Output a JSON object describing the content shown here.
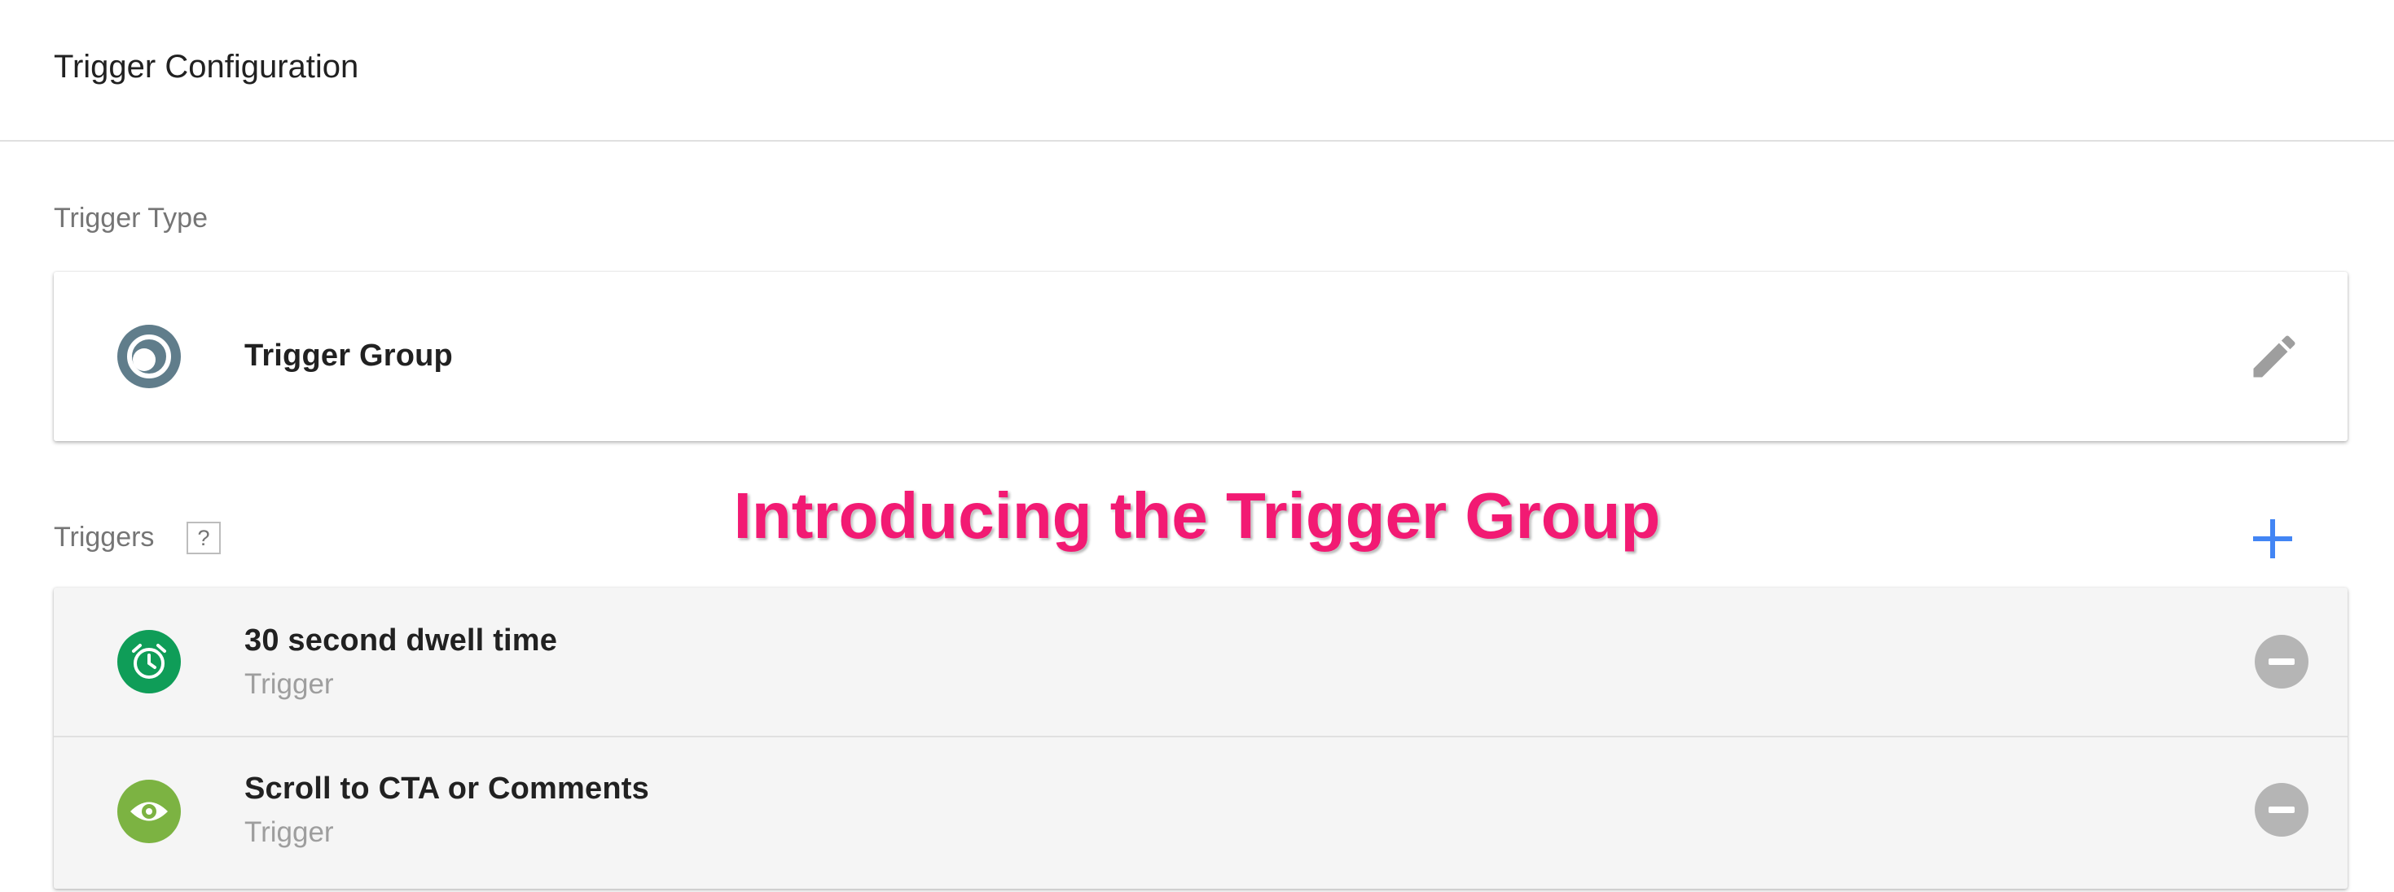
{
  "header": {
    "title": "Trigger Configuration"
  },
  "trigger_type": {
    "section_label": "Trigger Type",
    "selected": {
      "name": "Trigger Group",
      "icon": "trigger-group-icon",
      "icon_color": "#607d8b"
    },
    "edit_icon": "pencil-icon"
  },
  "triggers": {
    "section_label": "Triggers",
    "help_label": "?",
    "add_icon": "plus-icon",
    "items": [
      {
        "title": "30 second dwell time",
        "subtitle": "Trigger",
        "icon": "alarm-clock-icon",
        "icon_color": "#0f9d58"
      },
      {
        "title": "Scroll to CTA or Comments",
        "subtitle": "Trigger",
        "icon": "eye-icon",
        "icon_color": "#7cb342"
      }
    ]
  },
  "overlay": {
    "headline": "Introducing the Trigger Group",
    "color": "#f21a73"
  },
  "colors": {
    "accent": "#4285f4",
    "remove_button": "#b5b5b5"
  }
}
